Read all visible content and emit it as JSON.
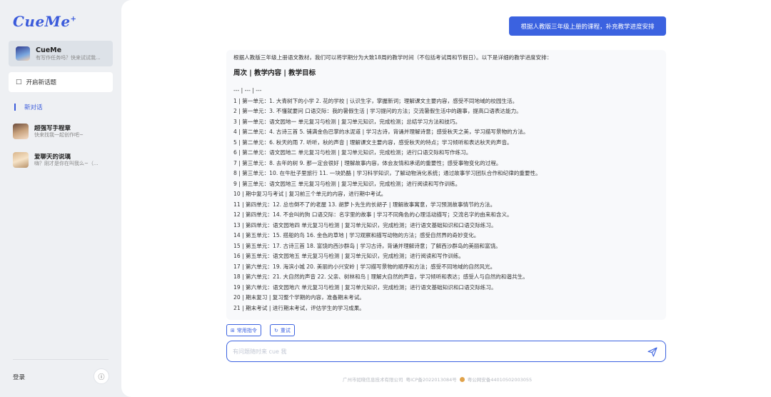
{
  "sidebar": {
    "logo": "CueMe",
    "logo_mark": "+",
    "bot": {
      "name": "CueMe",
      "subtitle": "有写作任务吗？快来试试我..."
    },
    "new_topic_label": "开启新话题",
    "new_chat_label": "新对话",
    "conversations": [
      {
        "name": "超强写手程章",
        "subtitle": "快来找我一起创作吧~"
      },
      {
        "name": "爱聊天的说璃",
        "subtitle": "嗨？刚才是你在叫我么~（..."
      }
    ],
    "login_label": "登录",
    "info_icon": "info-icon"
  },
  "chat": {
    "user_message": "根据人教版三年级上册的课程，补充教学进度安排",
    "reply_intro": "根据人教版三年级上册语文教材，我们可以将学期分为大致18周的教学时间（不包括考试周和节假日）。以下是详细的教学进度安排：",
    "reply_heading": "周次 | 教学内容 | 教学目标",
    "reply_lines": [
      "--- | --- | ---",
      "1 | 第一单元：1. 大青树下的小学 2. 花的学校 | 认识生字，掌握新词；理解课文主要内容，感受不同地域的校园生活。",
      "2 | 第一单元：3. 不懂就要问 口语交际：我的暑假生活 | 学习提问的方法；交流暑假生活中的趣事，提高口语表达能力。",
      "3 | 第一单元：语文园地一 单元复习与检测 | 复习单元知识，完成检测；总结学习方法和技巧。",
      "4 | 第二单元：4. 古诗三首 5. 铺满金色巴掌的水泥道 | 学习古诗，背诵并理解诗意；感受秋天之美，学习描写景物的方法。",
      "5 | 第二单元：6. 秋天的雨 7. 听听，秋的声音 | 理解课文主要内容，感受秋天的特点；学习倾听和表达秋天的声音。",
      "6 | 第二单元：语文园地二 单元复习与检测 | 复习单元知识，完成检测；进行口语交际和写作练习。",
      "7 | 第三单元：8. 去年的树 9. 那一定会很好 | 理解故事内容，体会友情和承诺的重要性；感受事物变化的过程。",
      "8 | 第三单元：10. 在牛肚子里旅行 11. 一块奶酪 | 学习科学知识，了解动物消化系统；通过故事学习团队合作和纪律的重要性。",
      "9 | 第三单元：语文园地三 单元复习与检测 | 复习单元知识，完成检测；进行阅读和写作训练。",
      "10 | 期中复习与考试 | 复习前三个单元的内容，进行期中考试。",
      "11 | 第四单元：12. 总也倒不了的老屋 13. 胡萝卜先生的长胡子 | 理解故事寓意，学习预测故事情节的方法。",
      "12 | 第四单元：14. 不会叫的狗 口语交际：名字里的故事 | 学习不同角色的心理活动描写；交流名字的由来和含义。",
      "13 | 第四单元：语文园地四 单元复习与检测 | 复习单元知识，完成检测；进行语文基础知识和口语交际练习。",
      "14 | 第五单元：15. 搭船的鸟 16. 金色的草地 | 学习观察和描写动物的方法；感受自然界的奇妙变化。",
      "15 | 第五单元：17. 古诗三首 18. 富饶的西沙群岛 | 学习古诗，背诵并理解诗意；了解西沙群岛的美丽和富饶。",
      "16 | 第五单元：语文园地五 单元复习与检测 | 复习单元知识，完成检测；进行阅读和写作训练。",
      "17 | 第六单元：19. 海滨小城 20. 美丽的小兴安岭 | 学习描写景物的顺序和方法；感受不同地域的自然风光。",
      "18 | 第六单元：21. 大自然的声音 22. 父亲、树林和鸟 | 理解大自然的声音，学习倾听和表达；感受人与自然的和谐共生。",
      "19 | 第六单元：语文园地六 单元复习与检测 | 复习单元知识，完成检测；进行语文基础知识和口语交际练习。",
      "20 | 期末复习 | 复习整个学期的内容，准备期末考试。",
      "21 | 期末考试 | 进行期末考试，评估学生的学习成果。"
    ],
    "chips": {
      "common_commands": "常用指令",
      "retry": "重试"
    },
    "input_placeholder": "有问题随时来 cue 我",
    "footer": {
      "company": "广州市如晓信息技术有限公司",
      "icp": "粤ICP备2022013084号",
      "police": "粤公网安备44010502003055"
    }
  },
  "colors": {
    "accent": "#3b62e0",
    "brand": "#3b5bdb"
  }
}
